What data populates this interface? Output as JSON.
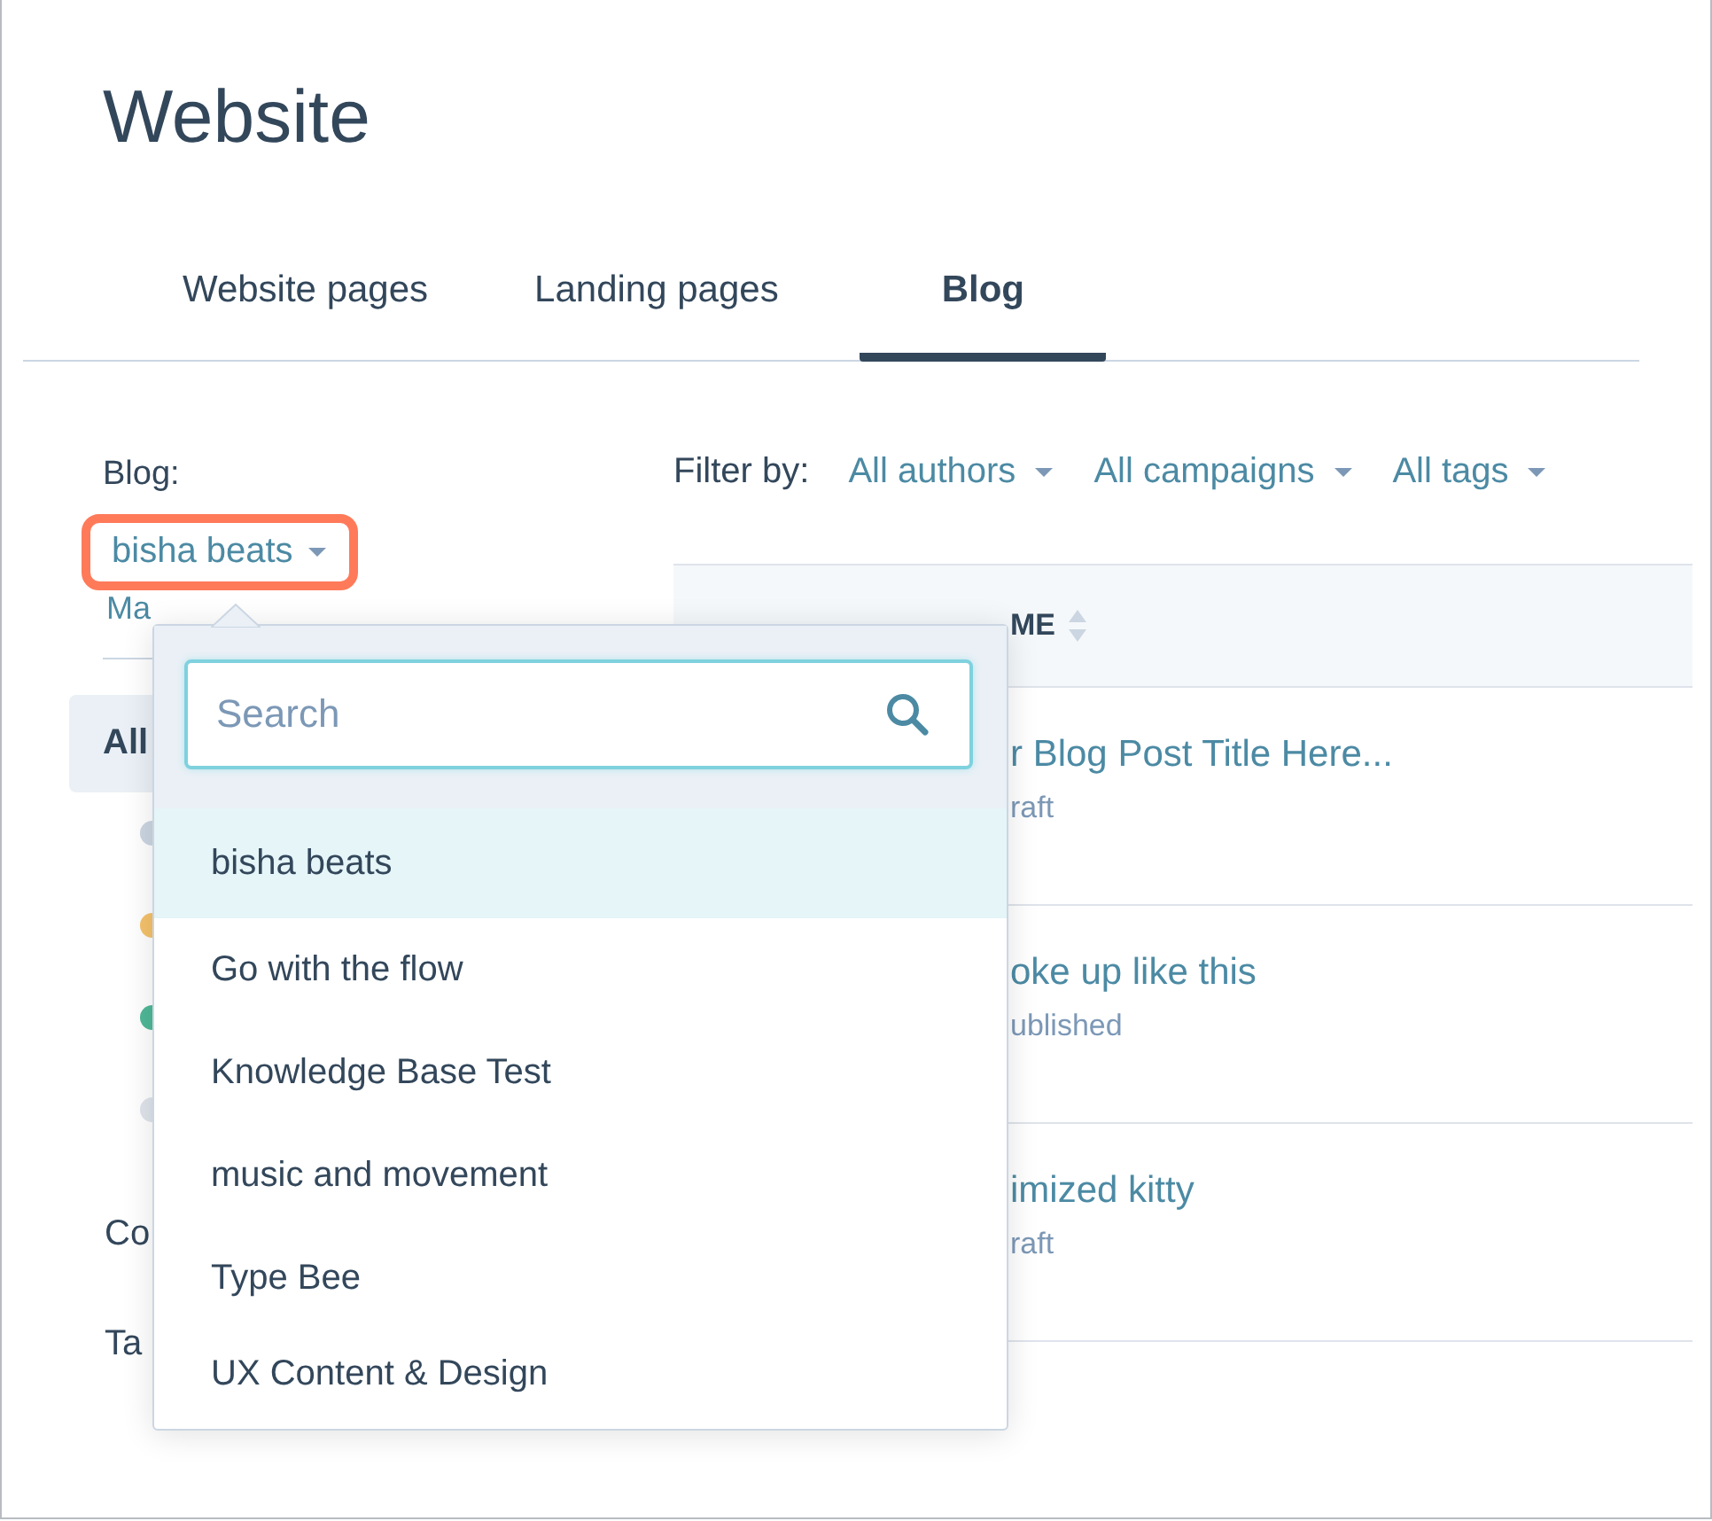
{
  "page_title": "Website",
  "tabs": [
    {
      "label": "Website pages",
      "selected": false
    },
    {
      "label": "Landing pages",
      "selected": false
    },
    {
      "label": "Blog",
      "selected": true
    }
  ],
  "blog_label": "Blog:",
  "blog_picker": {
    "value": "bisha beats",
    "highlighted": true
  },
  "filter": {
    "label": "Filter by:",
    "options": [
      "All authors",
      "All campaigns",
      "All tags"
    ]
  },
  "sidebar": {
    "link": "Ma",
    "items": [
      {
        "label": "All",
        "selected": true
      }
    ],
    "status_dots": [
      {
        "color": "#cbd6e2"
      },
      {
        "color": "#f5c26b"
      },
      {
        "color": "#4fb897"
      },
      {
        "color": "#dfe3eb"
      }
    ],
    "sections": [
      "Co",
      "Ta"
    ]
  },
  "table": {
    "column_1": "ME",
    "rows": [
      {
        "title": "r Blog Post Title Here...",
        "status": "raft"
      },
      {
        "title": "oke up like this",
        "status": "ublished"
      },
      {
        "title": "imized kitty",
        "status": "raft"
      }
    ]
  },
  "dropdown": {
    "search": {
      "placeholder": "Search"
    },
    "items": [
      {
        "label": "bisha beats",
        "selected": true
      },
      {
        "label": "Go with the flow",
        "selected": false
      },
      {
        "label": "Knowledge Base Test",
        "selected": false
      },
      {
        "label": "music and movement",
        "selected": false
      },
      {
        "label": "Type Bee",
        "selected": false
      },
      {
        "label": "UX Content & Design",
        "selected": false
      }
    ]
  }
}
